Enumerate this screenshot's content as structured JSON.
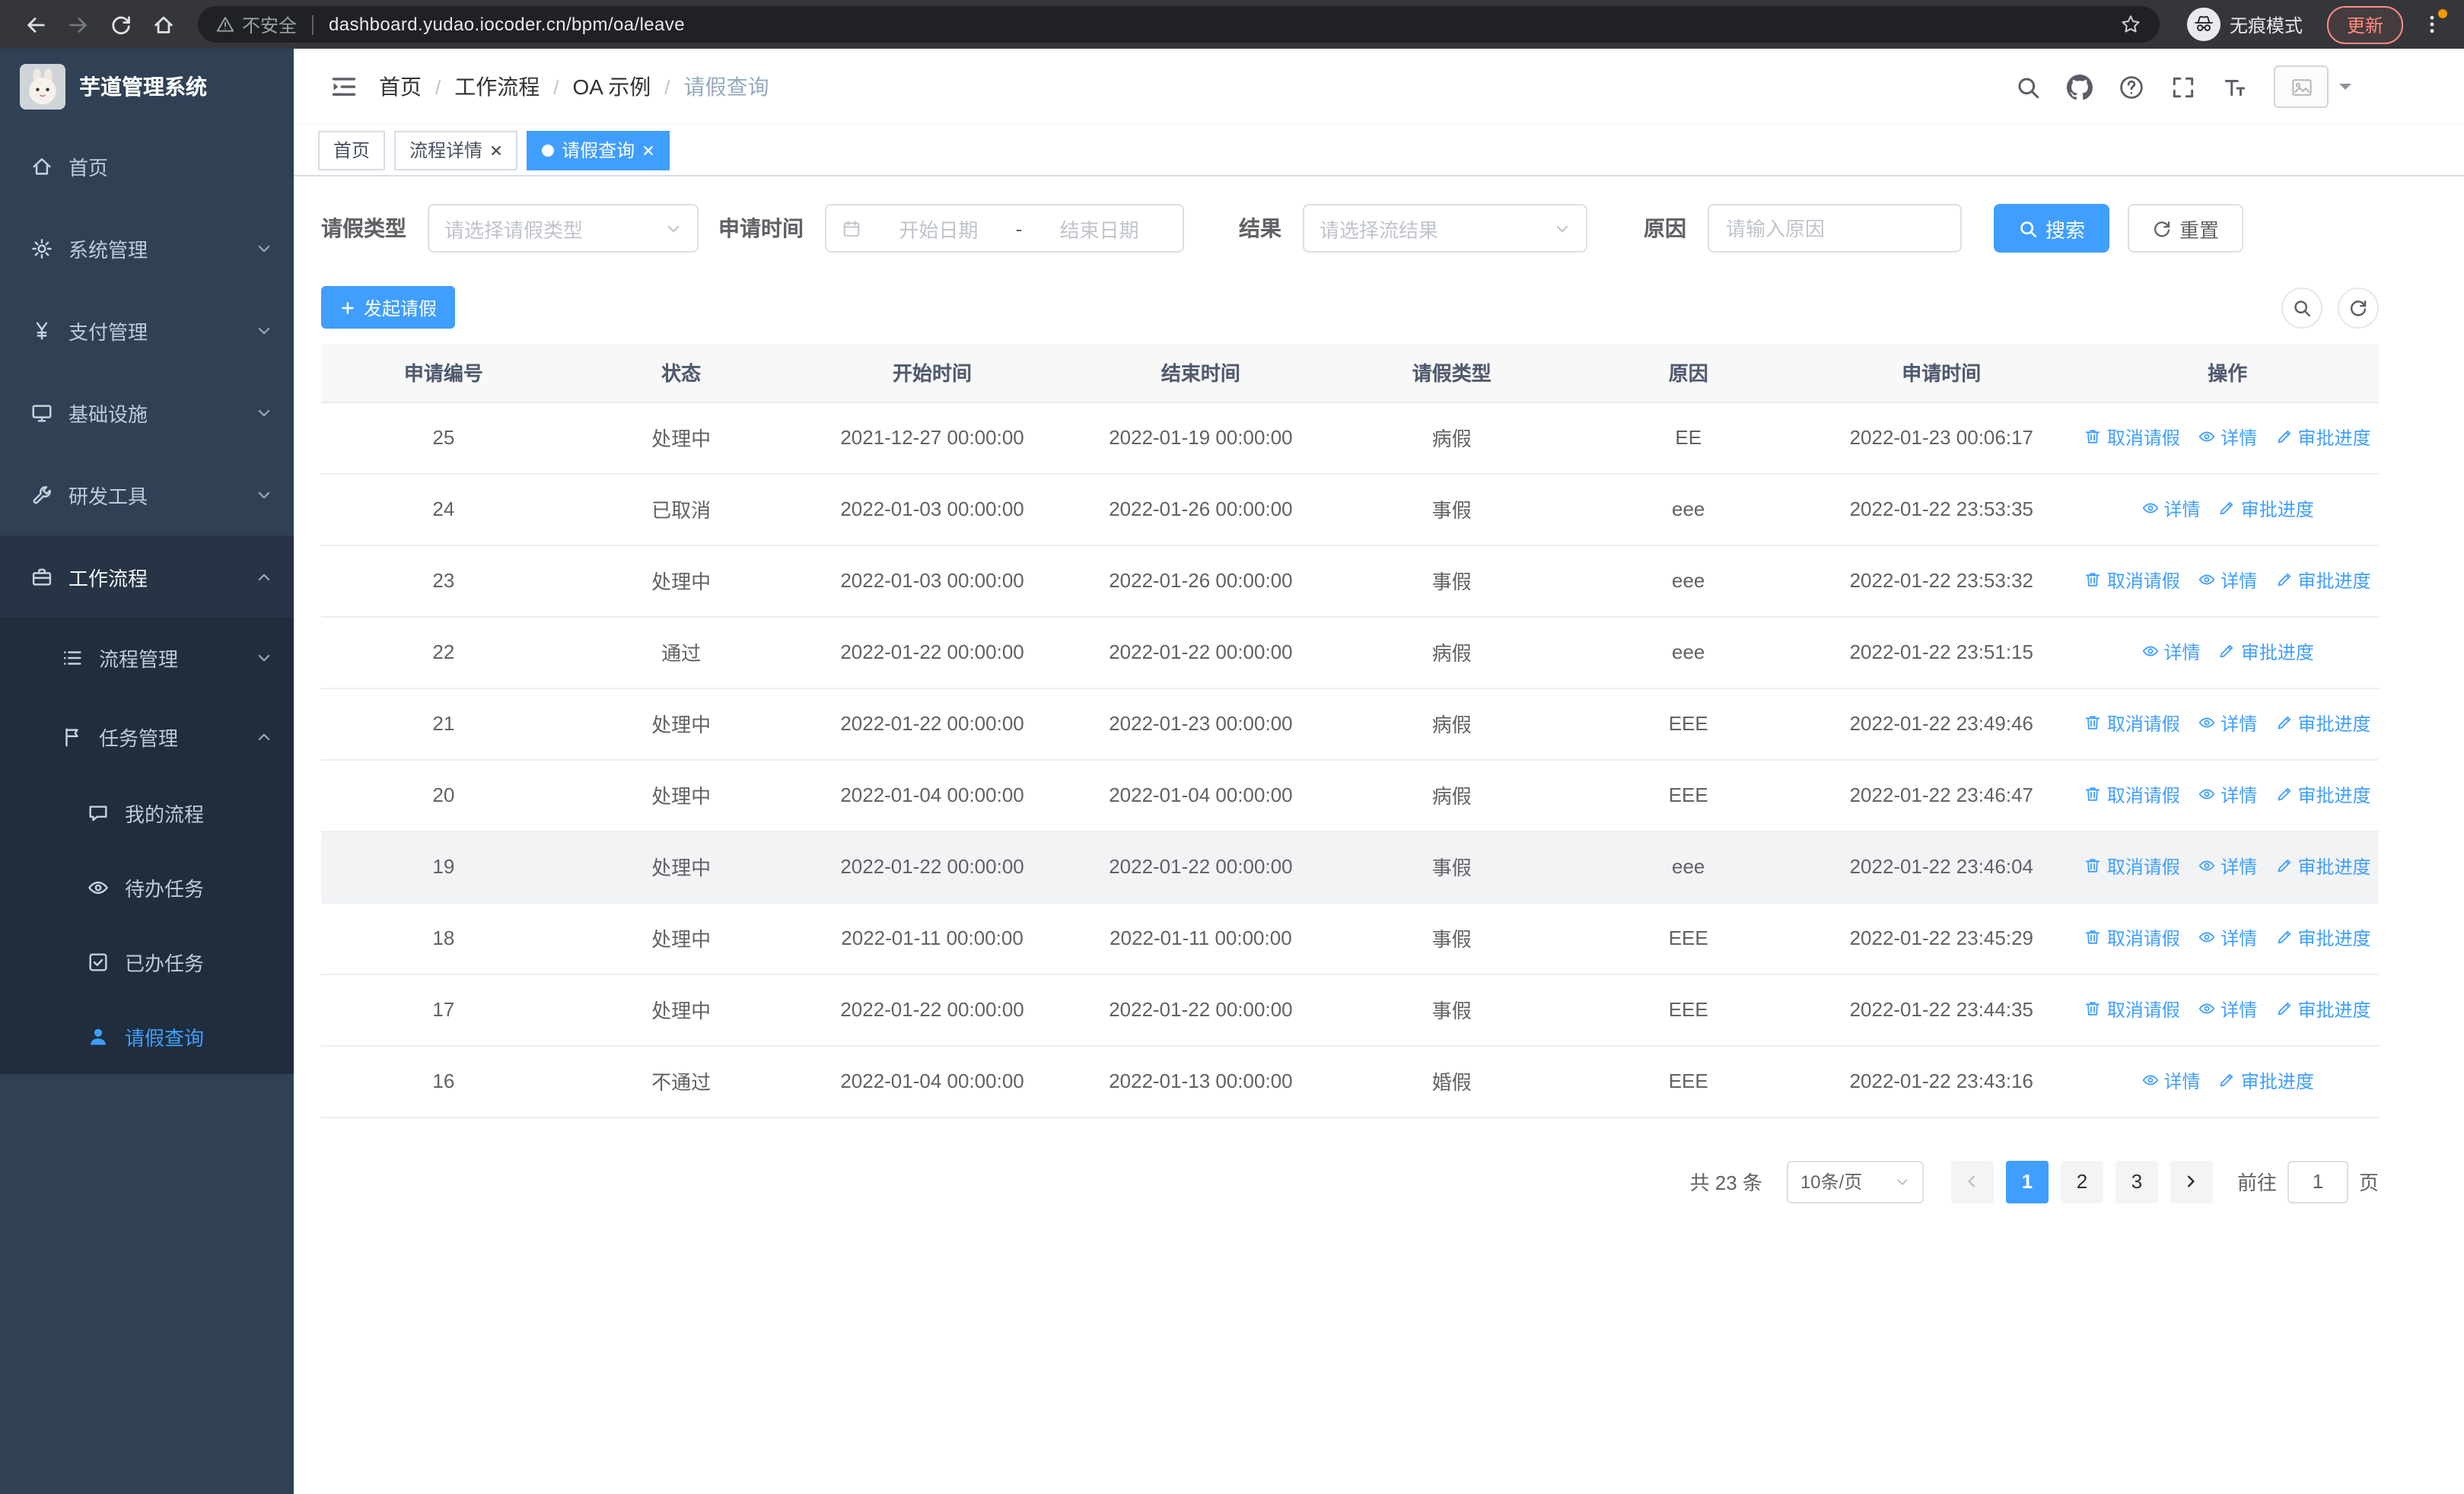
{
  "browser": {
    "security_label": "不安全",
    "url": "dashboard.yudao.iocoder.cn/bpm/oa/leave",
    "incognito_label": "无痕模式",
    "update_label": "更新"
  },
  "sidebar": {
    "app_title": "芋道管理系统",
    "menu": {
      "home": "首页",
      "system": "系统管理",
      "payment": "支付管理",
      "infra": "基础设施",
      "devtools": "研发工具",
      "workflow": "工作流程",
      "process_mgmt": "流程管理",
      "task_mgmt": "任务管理",
      "my_process": "我的流程",
      "todo_tasks": "待办任务",
      "done_tasks": "已办任务",
      "leave_query": "请假查询"
    }
  },
  "header": {
    "breadcrumbs": [
      "首页",
      "工作流程",
      "OA 示例",
      "请假查询"
    ]
  },
  "tabs": [
    {
      "label": "首页",
      "active": false,
      "closable": false
    },
    {
      "label": "流程详情",
      "active": false,
      "closable": true
    },
    {
      "label": "请假查询",
      "active": true,
      "closable": true
    }
  ],
  "filters": {
    "leave_type_label": "请假类型",
    "leave_type_placeholder": "请选择请假类型",
    "apply_time_label": "申请时间",
    "start_placeholder": "开始日期",
    "range_separator": "-",
    "end_placeholder": "结束日期",
    "result_label": "结果",
    "result_placeholder": "请选择流结果",
    "reason_label": "原因",
    "reason_placeholder": "请输入原因",
    "search_label": "搜索",
    "reset_label": "重置"
  },
  "toolbar": {
    "create_label": "发起请假"
  },
  "table": {
    "headers": [
      "申请编号",
      "状态",
      "开始时间",
      "结束时间",
      "请假类型",
      "原因",
      "申请时间",
      "操作"
    ],
    "action_labels": {
      "cancel": "取消请假",
      "detail": "详情",
      "progress": "审批进度"
    },
    "rows": [
      {
        "id": "25",
        "status": "处理中",
        "start_time": "2021-12-27 00:00:00",
        "end_time": "2022-01-19 00:00:00",
        "leave_type": "病假",
        "reason": "EE",
        "apply_time": "2022-01-23 00:06:17",
        "can_cancel": true,
        "highlighted": false
      },
      {
        "id": "24",
        "status": "已取消",
        "start_time": "2022-01-03 00:00:00",
        "end_time": "2022-01-26 00:00:00",
        "leave_type": "事假",
        "reason": "eee",
        "apply_time": "2022-01-22 23:53:35",
        "can_cancel": false,
        "highlighted": false
      },
      {
        "id": "23",
        "status": "处理中",
        "start_time": "2022-01-03 00:00:00",
        "end_time": "2022-01-26 00:00:00",
        "leave_type": "事假",
        "reason": "eee",
        "apply_time": "2022-01-22 23:53:32",
        "can_cancel": true,
        "highlighted": false
      },
      {
        "id": "22",
        "status": "通过",
        "start_time": "2022-01-22 00:00:00",
        "end_time": "2022-01-22 00:00:00",
        "leave_type": "病假",
        "reason": "eee",
        "apply_time": "2022-01-22 23:51:15",
        "can_cancel": false,
        "highlighted": false
      },
      {
        "id": "21",
        "status": "处理中",
        "start_time": "2022-01-22 00:00:00",
        "end_time": "2022-01-23 00:00:00",
        "leave_type": "病假",
        "reason": "EEE",
        "apply_time": "2022-01-22 23:49:46",
        "can_cancel": true,
        "highlighted": false
      },
      {
        "id": "20",
        "status": "处理中",
        "start_time": "2022-01-04 00:00:00",
        "end_time": "2022-01-04 00:00:00",
        "leave_type": "病假",
        "reason": "EEE",
        "apply_time": "2022-01-22 23:46:47",
        "can_cancel": true,
        "highlighted": false
      },
      {
        "id": "19",
        "status": "处理中",
        "start_time": "2022-01-22 00:00:00",
        "end_time": "2022-01-22 00:00:00",
        "leave_type": "事假",
        "reason": "eee",
        "apply_time": "2022-01-22 23:46:04",
        "can_cancel": true,
        "highlighted": true
      },
      {
        "id": "18",
        "status": "处理中",
        "start_time": "2022-01-11 00:00:00",
        "end_time": "2022-01-11 00:00:00",
        "leave_type": "事假",
        "reason": "EEE",
        "apply_time": "2022-01-22 23:45:29",
        "can_cancel": true,
        "highlighted": false
      },
      {
        "id": "17",
        "status": "处理中",
        "start_time": "2022-01-22 00:00:00",
        "end_time": "2022-01-22 00:00:00",
        "leave_type": "事假",
        "reason": "EEE",
        "apply_time": "2022-01-22 23:44:35",
        "can_cancel": true,
        "highlighted": false
      },
      {
        "id": "16",
        "status": "不通过",
        "start_time": "2022-01-04 00:00:00",
        "end_time": "2022-01-13 00:00:00",
        "leave_type": "婚假",
        "reason": "EEE",
        "apply_time": "2022-01-22 23:43:16",
        "can_cancel": false,
        "highlighted": false
      }
    ]
  },
  "pagination": {
    "total_text": "共 23 条",
    "page_size_label": "10条/页",
    "pages": [
      "1",
      "2",
      "3"
    ],
    "goto_label": "前往",
    "goto_value": "1",
    "goto_suffix": "页"
  }
}
